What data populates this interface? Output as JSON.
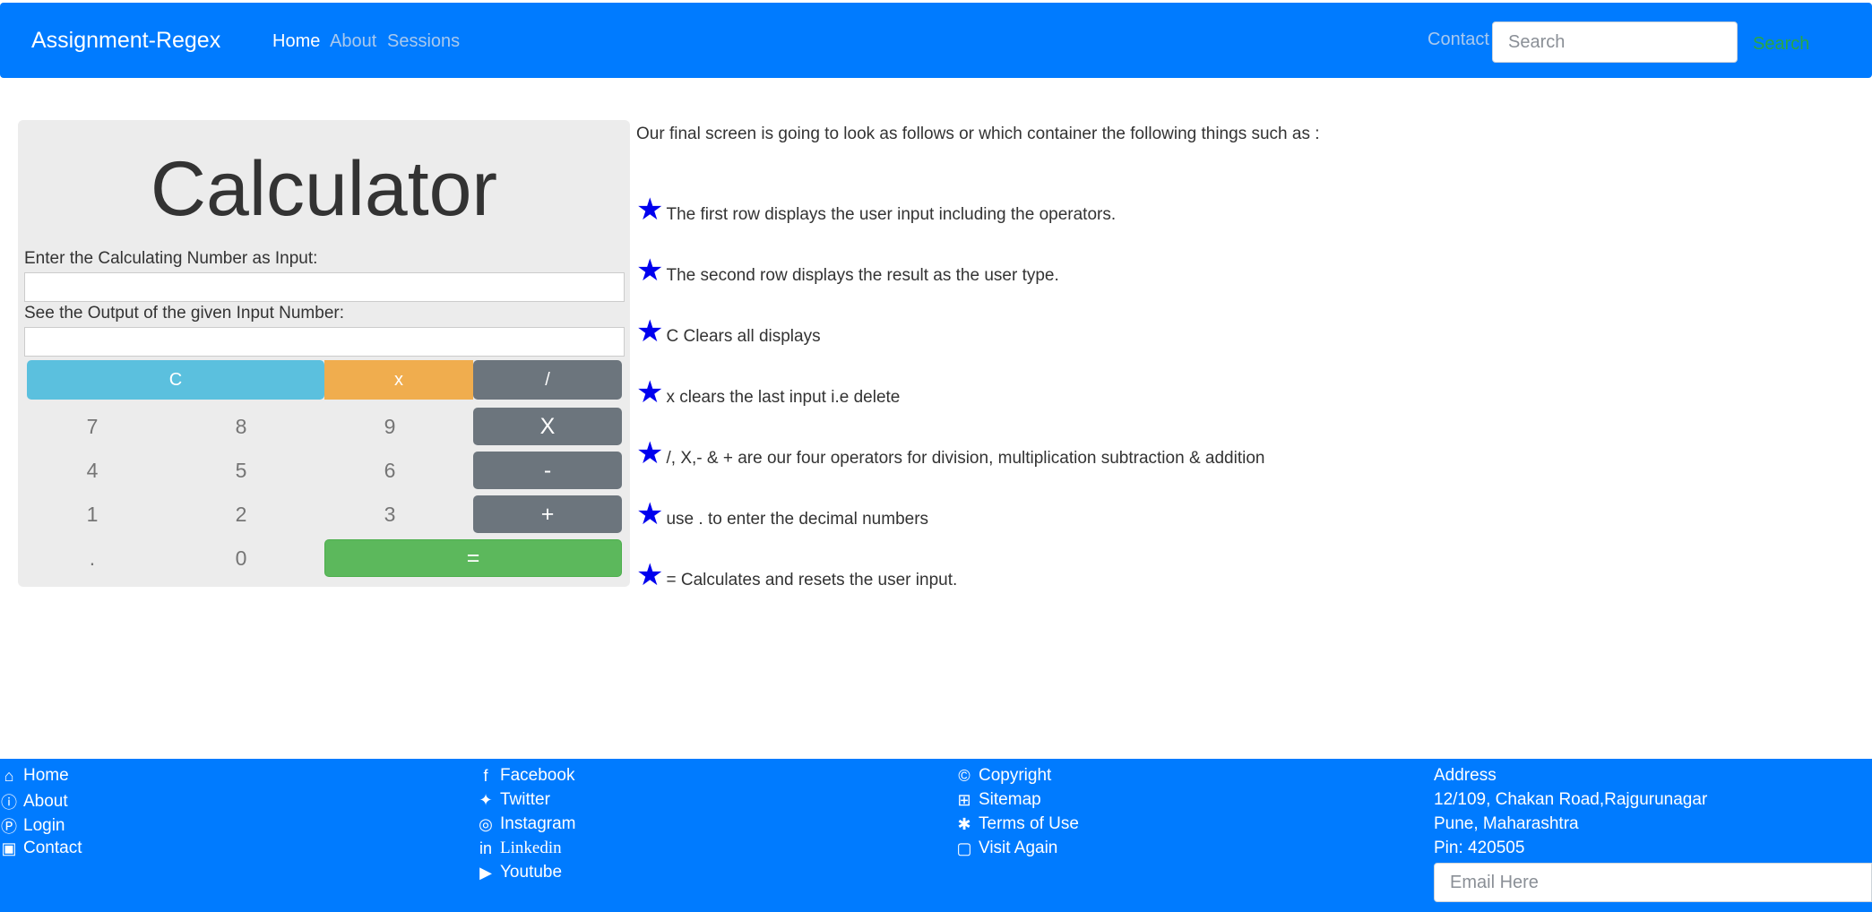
{
  "navbar": {
    "brand": "Assignment-Regex",
    "links": [
      "Home",
      "About",
      "Sessions"
    ],
    "contact": "Contact",
    "search_placeholder": "Search",
    "search_button": "Search"
  },
  "calculator": {
    "title": "Calculator",
    "input_label": "Enter the Calculating Number as Input:",
    "output_label": "See the Output of the given Input Number:",
    "keys": {
      "clear": "C",
      "backspace": "x",
      "divide": "/",
      "seven": "7",
      "eight": "8",
      "nine": "9",
      "multiply": "X",
      "four": "4",
      "five": "5",
      "six": "6",
      "minus": "-",
      "one": "1",
      "two": "2",
      "three": "3",
      "plus": "+",
      "dot": ".",
      "zero": "0",
      "equals": "="
    }
  },
  "instructions": {
    "intro": "Our final screen is going to look as follows or which container the following things such as :",
    "items": [
      "The first row displays the user input including the operators.",
      "The second row displays the result as the user type.",
      "C Clears all displays",
      "x clears the last input i.e delete",
      "/, X,- & + are our four operators for division, multiplication subtraction & addition",
      "use . to enter the decimal numbers",
      "= Calculates and resets the user input."
    ]
  },
  "footer": {
    "nav": [
      "Home",
      "About",
      "Login",
      "Contact"
    ],
    "social": [
      "Facebook",
      "Twitter",
      "Instagram",
      "Linkedin",
      "Youtube"
    ],
    "legal": [
      "Copyright",
      "Sitemap",
      "Terms of Use",
      "Visit Again"
    ],
    "address": [
      "Address",
      "12/109, Chakan Road,Rajgurunagar",
      "Pune, Maharashtra",
      "Pin: 420505"
    ],
    "email_placeholder": "Email Here"
  },
  "icons": {
    "home": "home-icon",
    "about": "info-icon",
    "login": "login-icon",
    "contact": "contact-card-icon",
    "facebook": "facebook-icon",
    "twitter": "twitter-icon",
    "instagram": "instagram-icon",
    "linkedin": "linkedin-icon",
    "youtube": "youtube-icon",
    "copyright": "copyright-icon",
    "sitemap": "sitemap-icon",
    "terms": "asterisk-icon",
    "visit": "note-icon",
    "star": "star-icon"
  },
  "colors": {
    "primary": "#007bff",
    "info": "#5bc0de",
    "warning": "#f0ad4e",
    "dark": "#6c757d",
    "success": "#5cb85c",
    "star": "#0000ee",
    "search_text": "#28a745"
  }
}
